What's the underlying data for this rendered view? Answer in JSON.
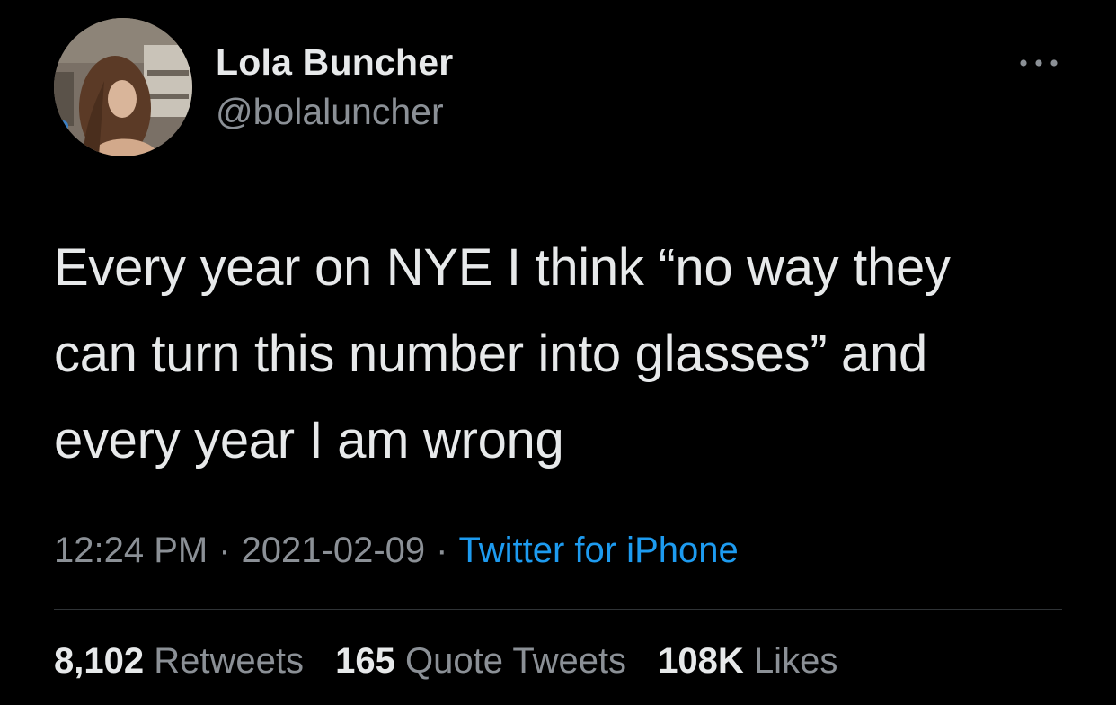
{
  "author": {
    "display_name": "Lola Buncher",
    "handle": "@bolaluncher"
  },
  "tweet": {
    "text": "Every year on NYE I think “no way they\ncan turn this number into glasses” and\nevery year I am wrong"
  },
  "meta": {
    "time": "12:24 PM",
    "separator": "·",
    "date": "2021-02-09",
    "source": "Twitter for iPhone"
  },
  "stats": {
    "retweets": {
      "count": "8,102",
      "label": "Retweets"
    },
    "quote_tweets": {
      "count": "165",
      "label": "Quote Tweets"
    },
    "likes": {
      "count": "108K",
      "label": "Likes"
    }
  },
  "icons": {
    "more": "more-options-icon"
  },
  "colors": {
    "background": "#000000",
    "text": "#e7e9ea",
    "secondary": "#8b9096",
    "link": "#1d9bf0",
    "divider": "#2f3336"
  }
}
